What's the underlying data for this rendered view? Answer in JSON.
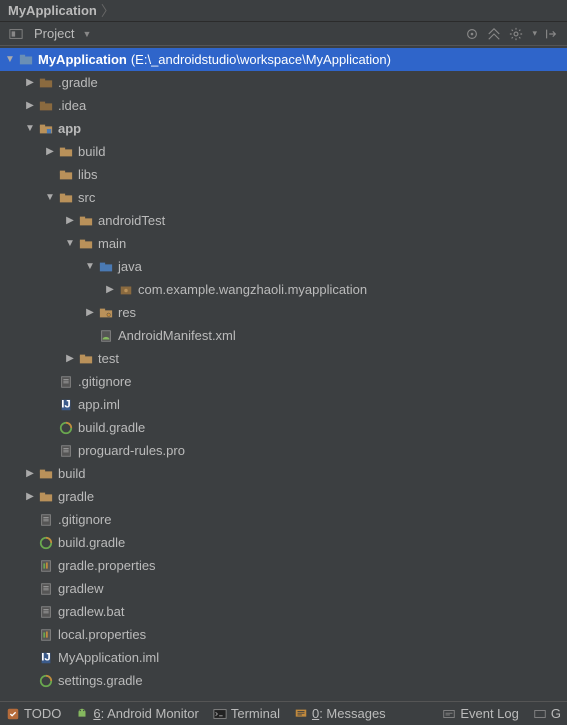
{
  "breadcrumb": {
    "root": "MyApplication"
  },
  "toolbar": {
    "view_label": "Project",
    "icons": {
      "target": "target-icon",
      "collapse": "collapse-icon",
      "settings": "settings-icon",
      "hide": "hide-icon"
    }
  },
  "tree": {
    "root": {
      "label": "MyApplication",
      "path": "(E:\\_androidstudio\\workspace\\MyApplication)"
    },
    "items": [
      {
        "indent": 1,
        "arrow": "right",
        "icon": "folder-config",
        "label": ".gradle"
      },
      {
        "indent": 1,
        "arrow": "right",
        "icon": "folder-config",
        "label": ".idea"
      },
      {
        "indent": 1,
        "arrow": "down",
        "icon": "module",
        "label": "app",
        "bold": true
      },
      {
        "indent": 2,
        "arrow": "right",
        "icon": "folder",
        "label": "build"
      },
      {
        "indent": 2,
        "arrow": "none",
        "icon": "folder",
        "label": "libs"
      },
      {
        "indent": 2,
        "arrow": "down",
        "icon": "folder",
        "label": "src"
      },
      {
        "indent": 3,
        "arrow": "right",
        "icon": "folder",
        "label": "androidTest"
      },
      {
        "indent": 3,
        "arrow": "down",
        "icon": "folder",
        "label": "main"
      },
      {
        "indent": 4,
        "arrow": "down",
        "icon": "folder-source",
        "label": "java"
      },
      {
        "indent": 5,
        "arrow": "right",
        "icon": "package",
        "label": "com.example.wangzhaoli.myapplication"
      },
      {
        "indent": 4,
        "arrow": "right",
        "icon": "folder-resource",
        "label": "res"
      },
      {
        "indent": 4,
        "arrow": "none",
        "icon": "xml-manifest",
        "label": "AndroidManifest.xml"
      },
      {
        "indent": 3,
        "arrow": "right",
        "icon": "folder",
        "label": "test"
      },
      {
        "indent": 2,
        "arrow": "none",
        "icon": "file",
        "label": ".gitignore"
      },
      {
        "indent": 2,
        "arrow": "none",
        "icon": "iml",
        "label": "app.iml"
      },
      {
        "indent": 2,
        "arrow": "none",
        "icon": "gradle",
        "label": "build.gradle"
      },
      {
        "indent": 2,
        "arrow": "none",
        "icon": "file",
        "label": "proguard-rules.pro"
      },
      {
        "indent": 1,
        "arrow": "right",
        "icon": "folder",
        "label": "build"
      },
      {
        "indent": 1,
        "arrow": "right",
        "icon": "folder",
        "label": "gradle"
      },
      {
        "indent": 1,
        "arrow": "none",
        "icon": "file",
        "label": ".gitignore"
      },
      {
        "indent": 1,
        "arrow": "none",
        "icon": "gradle",
        "label": "build.gradle"
      },
      {
        "indent": 1,
        "arrow": "none",
        "icon": "properties",
        "label": "gradle.properties"
      },
      {
        "indent": 1,
        "arrow": "none",
        "icon": "file",
        "label": "gradlew"
      },
      {
        "indent": 1,
        "arrow": "none",
        "icon": "file",
        "label": "gradlew.bat"
      },
      {
        "indent": 1,
        "arrow": "none",
        "icon": "properties",
        "label": "local.properties"
      },
      {
        "indent": 1,
        "arrow": "none",
        "icon": "iml",
        "label": "MyApplication.iml"
      },
      {
        "indent": 1,
        "arrow": "none",
        "icon": "gradle",
        "label": "settings.gradle"
      }
    ]
  },
  "statusbar": {
    "todo": "TODO",
    "android_monitor_num": "6",
    "android_monitor": ": Android Monitor",
    "terminal": "Terminal",
    "messages_num": "0",
    "messages": ": Messages",
    "event_log": "Event Log",
    "gradle_console": "G"
  }
}
